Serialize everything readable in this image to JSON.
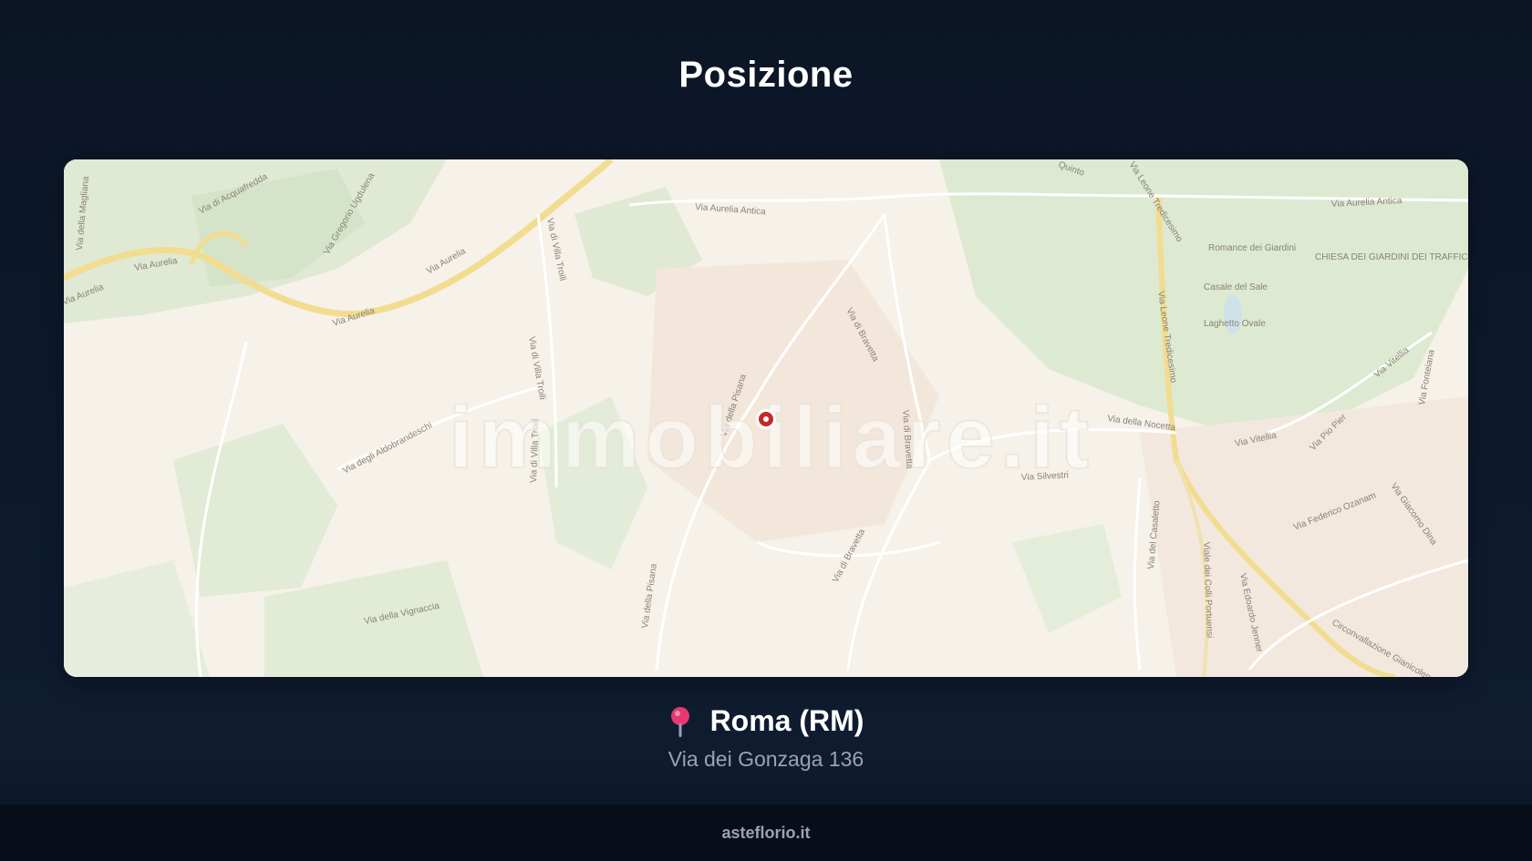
{
  "section": {
    "title": "Posizione"
  },
  "map": {
    "watermark": "immobiliare.it",
    "marker_color": "#c62828",
    "labels": {
      "via_aurelia_1": "Via Aurelia",
      "via_aurelia_2": "Via Aurelia",
      "via_aurelia_3": "Via Aurelia",
      "via_aurelia_4": "Via Aurelia",
      "via_aurelia_antica_1": "Via Aurelia Antica",
      "via_aurelia_antica_2": "Via Aurelia Antica",
      "via_acquafredda": "Via di Acquafredda",
      "via_magliana": "Via della Magliana",
      "via_gregorio": "Via Gregorio Ugdulena",
      "via_villa_troili_1": "Via di Villa Troili",
      "via_villa_troili_2": "Via di Villa Troili",
      "via_villa_troili_3": "Via di Villa Troili",
      "via_della_pisana_1": "Via della Pisana",
      "via_della_pisana_2": "Via della Pisana",
      "via_di_bravetta_1": "Via di Bravetta",
      "via_di_bravetta_2": "Via di Bravetta",
      "via_di_bravetta_3": "Via di Bravetta",
      "via_aldobrandeschi": "Via degli Aldobrandeschi",
      "via_silvestri": "Via Silvestri",
      "via_della_nocetta": "Via della Nocetta",
      "via_vitellia": "Via Vitellia",
      "via_leone_xiii": "Via Leone Tredicesimo",
      "via_leone_xiii_top": "Via Leone Tredicesimo",
      "via_quinto": "Quinto",
      "via_casaletto": "Via del Casaletto",
      "viale_colli_portuensi": "Viale dei Colli Portuensi",
      "via_federico_ozanam": "Via Federico Ozanam",
      "via_giacomo_dina": "Via Giacomo Dina",
      "via_pio_pier": "Via Pio Pier",
      "circonvallazione": "Circonvallazione Gianicolense",
      "via_val_padana": "Via della Vignaccia",
      "via_edoardo": "Via Edoardo Jenner",
      "via_vitellia2": "Via Vitellia",
      "via_fonteiana": "Via Fonteiana",
      "casale": "Casale del Sale",
      "laghetto": "Laghetto Ovale",
      "giardino": "Romance dei Giardini",
      "chiesa": "CHIESA DEI GIARDINI DEI TRAFFIC"
    }
  },
  "location": {
    "city": "Roma (RM)",
    "address": "Via dei Gonzaga 136",
    "pin_color": "#e53970"
  },
  "footer": {
    "brand": "asteflorio.it"
  }
}
